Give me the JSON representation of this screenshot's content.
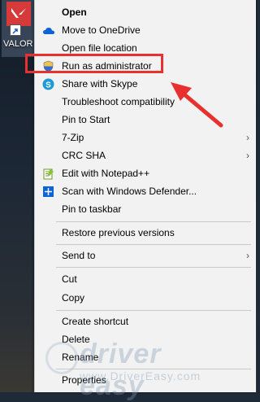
{
  "desktop": {
    "icon_label": "VALOR"
  },
  "context_menu": {
    "items": [
      {
        "label": "Open",
        "icon": "none",
        "bold": true
      },
      {
        "label": "Move to OneDrive",
        "icon": "onedrive-cloud-icon"
      },
      {
        "label": "Open file location",
        "icon": "none"
      },
      {
        "label": "Run as administrator",
        "icon": "uac-shield-icon"
      },
      {
        "label": "Share with Skype",
        "icon": "skype-icon"
      },
      {
        "label": "Troubleshoot compatibility",
        "icon": "none"
      },
      {
        "label": "Pin to Start",
        "icon": "none"
      },
      {
        "label": "7-Zip",
        "icon": "none",
        "submenu": true
      },
      {
        "label": "CRC SHA",
        "icon": "none",
        "submenu": true
      },
      {
        "label": "Edit with Notepad++",
        "icon": "notepadpp-icon"
      },
      {
        "label": "Scan with Windows Defender...",
        "icon": "windows-defender-icon"
      },
      {
        "label": "Pin to taskbar",
        "icon": "none"
      },
      {
        "label": "Restore previous versions",
        "icon": "none"
      },
      {
        "label": "Send to",
        "icon": "none",
        "submenu": true
      },
      {
        "label": "Cut",
        "icon": "none"
      },
      {
        "label": "Copy",
        "icon": "none"
      },
      {
        "label": "Create shortcut",
        "icon": "none"
      },
      {
        "label": "Delete",
        "icon": "none"
      },
      {
        "label": "Rename",
        "icon": "none"
      },
      {
        "label": "Properties",
        "icon": "none"
      }
    ],
    "submenu_glyph": "›"
  },
  "annotation": {
    "highlight_color": "#e8312f",
    "arrow_color": "#e8312f"
  },
  "watermark": {
    "name": "driver easy",
    "url": "www.DriverEasy.com"
  }
}
